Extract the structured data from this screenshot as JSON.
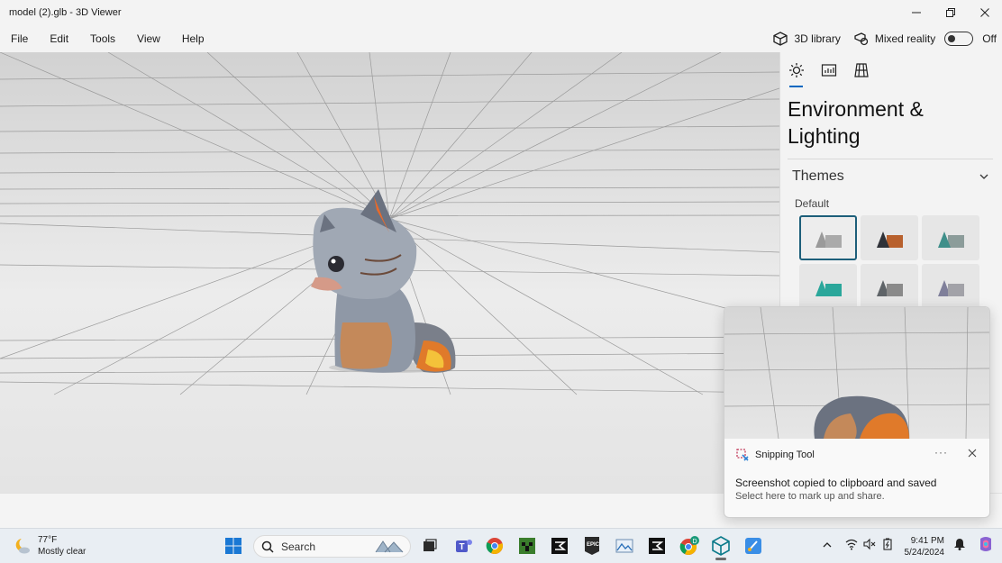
{
  "window": {
    "title": "model (2).glb - 3D Viewer",
    "minimize_icon": "minimize-icon",
    "maximize_icon": "restore-icon",
    "close_icon": "close-icon"
  },
  "menu": {
    "items": [
      "File",
      "Edit",
      "Tools",
      "View",
      "Help"
    ],
    "library_label": "3D library",
    "mixed_reality_label": "Mixed reality",
    "toggle_state": "Off"
  },
  "panel": {
    "tabs": [
      "environment-lighting-tab",
      "stats-tab",
      "grid-tab"
    ],
    "heading_line1": "Environment &",
    "heading_line2": "Lighting",
    "themes_label": "Themes",
    "default_label": "Default",
    "swatches": [
      {
        "name": "gray",
        "shape": "#9a9a9a",
        "accent": "#9a9a9a"
      },
      {
        "name": "dark-orange",
        "shape": "#2f3238",
        "accent": "#b8612e"
      },
      {
        "name": "teal-gray",
        "shape": "#3f8f8a",
        "accent": "#8c9c9a"
      },
      {
        "name": "teal",
        "shape": "#2aa79b",
        "accent": "#2aa79b"
      },
      {
        "name": "charcoal",
        "shape": "#5f6468",
        "accent": "#8a8a8a"
      },
      {
        "name": "lavender",
        "shape": "#7f7f9a",
        "accent": "#a2a2a8"
      }
    ]
  },
  "toast": {
    "app": "Snipping Tool",
    "more": "···",
    "message": "Screenshot copied to clipboard and saved",
    "sub": "Select here to mark up and share."
  },
  "taskbar": {
    "temperature": "77°F",
    "condition": "Mostly clear",
    "search_placeholder": "Search",
    "chrome_badge": "D",
    "time": "9:41 PM",
    "date": "5/24/2024"
  },
  "colors": {
    "accent": "#0067c0",
    "selected_swatch_border": "#1d5f7a"
  }
}
